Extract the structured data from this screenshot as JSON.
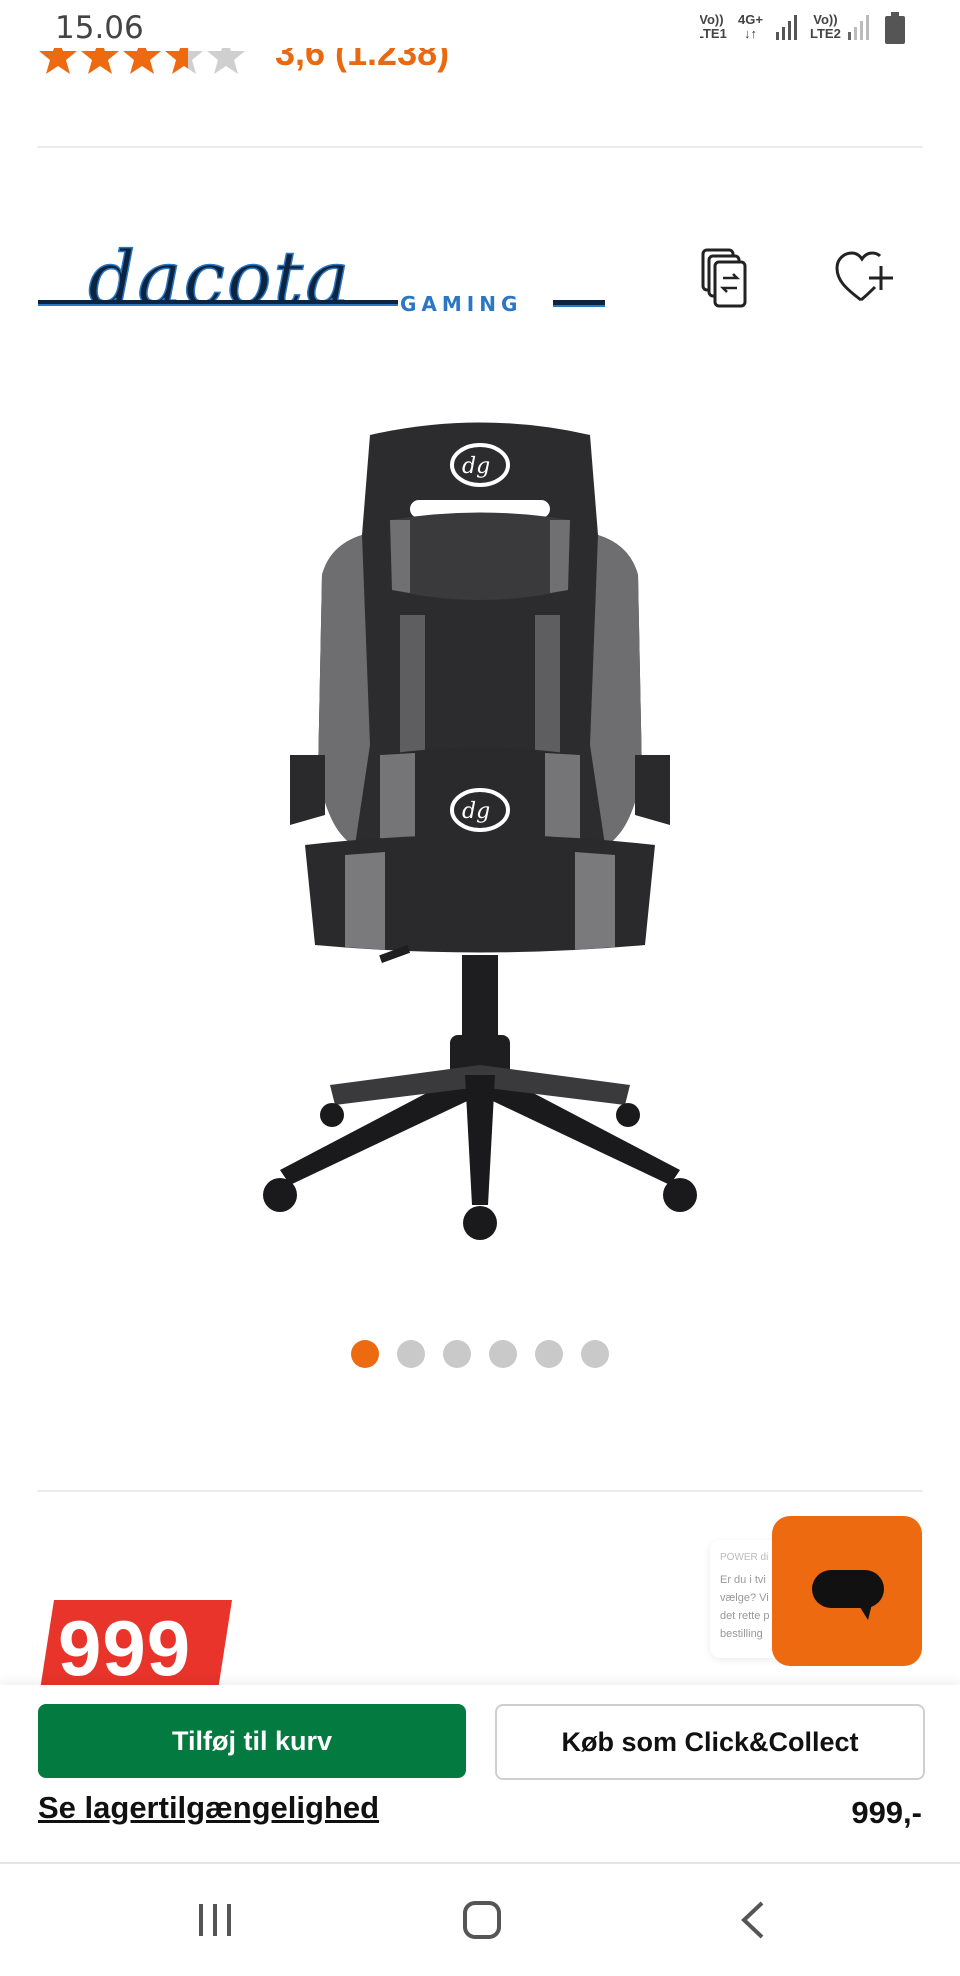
{
  "status_bar": {
    "time": "15.06",
    "sim1_top": "Vo))",
    "sim1_bottom": "LTE1",
    "net_top": "4G+",
    "net_bottom": "↓↑",
    "sim2_top": "Vo))",
    "sim2_bottom": "LTE2"
  },
  "rating": {
    "value": 3.6,
    "max": 5,
    "text": "3,6 (1.238)"
  },
  "brand": {
    "logo_word": "dacota",
    "logo_sub": "GAMING"
  },
  "actions": {
    "compare_icon": "compare-icon",
    "wishlist_icon": "heart-plus-icon"
  },
  "gallery": {
    "total_images": 6,
    "active_index": 1
  },
  "price": {
    "badge": "999",
    "bottom": "999,-"
  },
  "chat_popup": {
    "title": "POWER di",
    "lines": [
      "Er du i tvi",
      "vælge? Vi",
      "det rette p",
      "bestilling"
    ]
  },
  "buttons": {
    "add_to_cart": "Tilføj til kurv",
    "click_collect": "Køb som Click&Collect",
    "stock_link": "Se lagertilgængelighed"
  },
  "colors": {
    "accent": "#ee6a10",
    "cart_green": "#037a3f",
    "price_red": "#e8342b"
  }
}
